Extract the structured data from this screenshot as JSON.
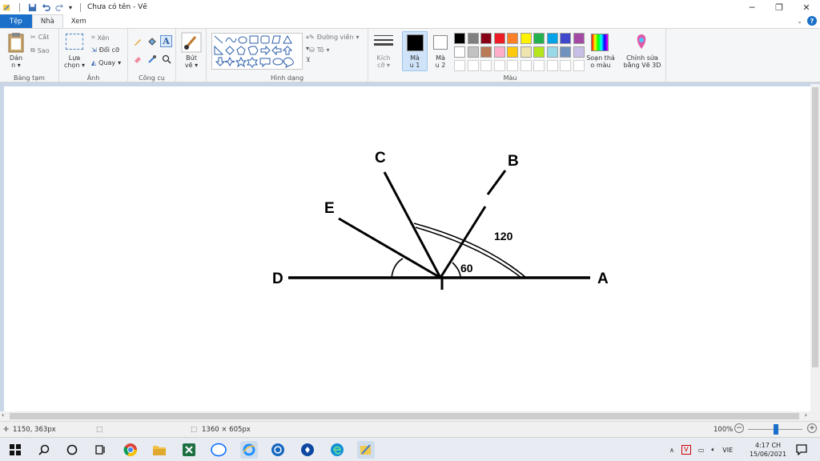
{
  "window": {
    "title": "Chưa có tên - Vẽ"
  },
  "tabs": [
    "Tệp",
    "Nhà",
    "Xem"
  ],
  "ribbon": {
    "clipboard": {
      "paste": "Dán",
      "cut": "Cắt",
      "copy": "Sao",
      "label": "Bảng tạm"
    },
    "image": {
      "select": "Lựa chọn",
      "crop": "Xén",
      "resize": "Đổi cỡ",
      "rotate": "Quay",
      "label": "Ảnh"
    },
    "tools": {
      "label": "Công cụ"
    },
    "brushes": {
      "label": "Bút vẽ"
    },
    "shapes": {
      "outline": "Đường viền",
      "fill": "Tô",
      "label": "Hình dạng"
    },
    "size": {
      "label": "Kích cỡ"
    },
    "color1": {
      "label": "Màu 1"
    },
    "color2": {
      "label": "Màu 2"
    },
    "colors": {
      "label": "Màu",
      "row1": [
        "#000000",
        "#7f7f7f",
        "#880015",
        "#ed1c24",
        "#ff7f27",
        "#fff200",
        "#22b14c",
        "#00a2e8",
        "#3f48cc",
        "#a349a4"
      ],
      "row2": [
        "#ffffff",
        "#c3c3c3",
        "#b97a57",
        "#ffaec9",
        "#ffc90e",
        "#efe4b0",
        "#b5e61d",
        "#99d9ea",
        "#7092be",
        "#c8bfe7"
      ]
    },
    "edit_colors": "Soạn thảo màu",
    "paint3d": "Chỉnh sửa bằng Vẽ 3D"
  },
  "drawing": {
    "labels": {
      "A": "A",
      "B": "B",
      "C": "C",
      "D": "D",
      "E": "E"
    },
    "angle_small": "60",
    "angle_large": "120"
  },
  "status": {
    "cursor": "1150, 363px",
    "canvas_size": "1360 × 605px",
    "zoom": "100%",
    "zoom_level": 100
  },
  "taskbar": {
    "lang": "VIE",
    "time": "4:17 CH",
    "date": "15/06/2021"
  }
}
